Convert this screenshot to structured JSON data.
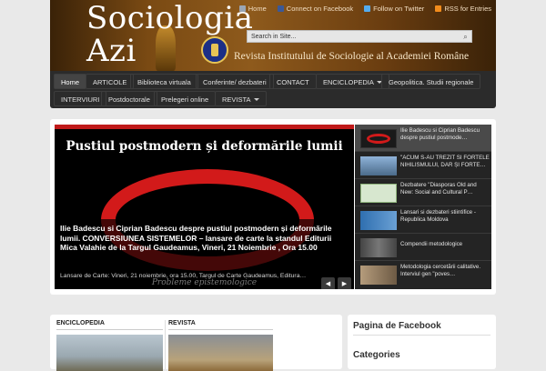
{
  "header": {
    "title": "Sociologia Azi",
    "tagline": "Revista Institutului de Sociologie al Academiei Române",
    "links": [
      {
        "label": "Home",
        "icon": "home-icon",
        "color": "#9aa6b5"
      },
      {
        "label": "Connect on Facebook",
        "icon": "facebook-icon",
        "color": "#3b5998"
      },
      {
        "label": "Follow on Twitter",
        "icon": "twitter-icon",
        "color": "#55acee"
      },
      {
        "label": "RSS for Entries",
        "icon": "rss-icon",
        "color": "#f28c1c"
      }
    ],
    "search_placeholder": "Search in Site..."
  },
  "nav": {
    "row1": [
      {
        "label": "Home",
        "active": true
      },
      {
        "label": "ARTICOLE"
      },
      {
        "label": "Biblioteca virtuala"
      },
      {
        "label": "Conferinte/ dezbateri"
      },
      {
        "label": "CONTACT"
      },
      {
        "label": "ENCICLOPEDIA",
        "dropdown": true
      },
      {
        "label": "Geopolitica. Studii regionale"
      }
    ],
    "row2": [
      {
        "label": "INTERVIURI"
      },
      {
        "label": "Postdoctorale"
      },
      {
        "label": "Prelegeri online"
      },
      {
        "label": "REVISTA",
        "dropdown": true
      }
    ]
  },
  "slider": {
    "slide_heading": "Pustiul postmodern și deformările lumii",
    "caption_title": "Ilie Badescu si Ciprian Badescu despre pustiul postmodern și deformările lumii. CONVERSIUNEA SISTEMELOR – lansare de carte la standul Editurii Mica Valahie de la Targul Gaudeamus, Vineri, 21 Noiembrie , Ora 15.00",
    "caption_text": "Lansare de Carte: Vineri, 21 noiembrie, ora 15.00, Targul de Carte Gaudeamus, Editura…",
    "watermark": "Probleme epistemologice",
    "prev": "◀",
    "next": "▶",
    "thumbs": [
      {
        "text": "Ilie Badescu si Ciprian Badescu despre pustiul postmode…",
        "color": "#1a1a1a",
        "active": true
      },
      {
        "text": "\"ACUM S-AU TREZIT SI FORTELE NIHILISMULUI, DAR ȘI FORTE…",
        "color": "#6c8fb3"
      },
      {
        "text": "Dezbatere \"Diasporas Old and New: Social and Cultural P…",
        "color": "#d7e7cf"
      },
      {
        "text": "Lansari si dezbateri stiintifice - Republica Moldova",
        "color": "#2f6fb0"
      },
      {
        "text": "Compendii metodologice",
        "color": "#5a5a5a"
      },
      {
        "text": "Metodologia cercetării calitative. Interviul gen \"poves…",
        "color": "#8a7a66"
      }
    ]
  },
  "sections": {
    "col1": "ENCICLOPEDIA",
    "col2": "REVISTA",
    "sidebar_head1": "Pagina de Facebook",
    "sidebar_head2": "Categories"
  }
}
